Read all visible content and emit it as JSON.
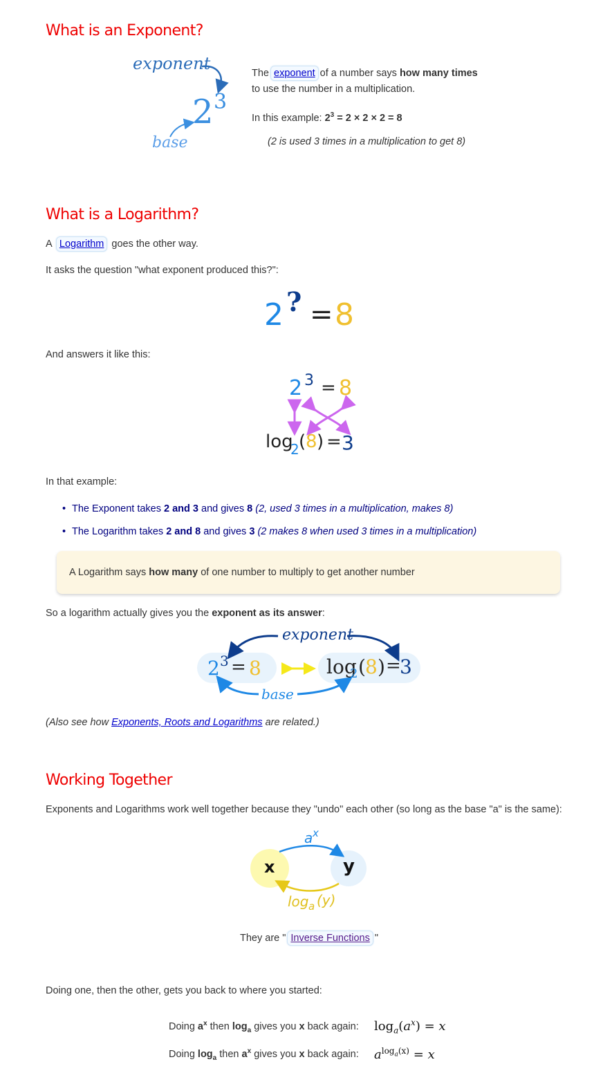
{
  "section1": {
    "heading": "What is an Exponent?",
    "figure": {
      "exponent_label": "exponent",
      "base_label": "base",
      "base": "2",
      "power": "3"
    },
    "p1_pre": "The",
    "p1_link": "exponent",
    "p1_mid": "of a number says",
    "p1_bold": "how many times",
    "p1_line2": "to use the number in a multiplication.",
    "p2_pre": "In this example:",
    "p2_base": "2",
    "p2_sup": "3",
    "p2_rest": "= 2 × 2 × 2 = 8",
    "p3": "(2 is used 3 times in a multiplication to get 8)"
  },
  "section2": {
    "heading": "What is a Logarithm?",
    "p1_pre": "A",
    "p1_link": "Logarithm",
    "p1_post": "goes the other way.",
    "p2": "It asks the question \"what exponent produced this?\":",
    "question": {
      "base": "2",
      "sup": "?",
      "eq": "=",
      "result": "8"
    },
    "p3": "And answers it like this:",
    "answer_fig": {
      "base": "2",
      "sup": "3",
      "eq": "=",
      "result": "8",
      "log": "log",
      "log_base": "2",
      "open": "(",
      "arg": "8",
      "close": ")",
      "eq2": "=",
      "answer": "3"
    },
    "p4": "In that example:",
    "bullets": [
      {
        "a": "The Exponent takes",
        "b": "2 and 3",
        "c": "and gives",
        "d": "8",
        "e": "(2, used 3 times in a multiplication, makes 8)"
      },
      {
        "a": "The Logarithm takes",
        "b": "2 and 8",
        "c": "and gives",
        "d": "3",
        "e": "(2 makes 8 when used 3 times in a multiplication)"
      }
    ],
    "note": {
      "pre": "A Logarithm says",
      "bold": "how many",
      "post": "of one number to multiply to get another number"
    },
    "p5_pre": "So a logarithm actually gives you the",
    "p5_bold": "exponent as its answer",
    "p5_post": ":",
    "diagram": {
      "exponent_label": "exponent",
      "base_label": "base",
      "left_base": "2",
      "left_sup": "3",
      "left_eq": "=",
      "left_result": "8",
      "log": "log",
      "log_base": "2",
      "open": "(",
      "arg": "8",
      "close": ")",
      "eq": "=",
      "answer": "3"
    },
    "p6_pre": "(Also see how",
    "p6_link": "Exponents, Roots and Logarithms",
    "p6_post": "are related.)"
  },
  "section3": {
    "heading": "Working Together",
    "p1": "Exponents and Logarithms work well together because they \"undo\" each other (so long as the base \"a\" is the same):",
    "fig": {
      "x": "x",
      "y": "y",
      "top_base": "a",
      "top_sup": "x",
      "bottom_log": "log",
      "bottom_sub": "a",
      "bottom_arg": "(y)"
    },
    "p2_pre": "They are \"",
    "p2_link": "Inverse Functions",
    "p2_post": "\"",
    "p3": "Doing one, then the other, gets you back to where you started:",
    "row1": {
      "a": "Doing",
      "b": "a",
      "b_sup": "x",
      "c": "then",
      "d": "log",
      "d_sub": "a",
      "e": "gives you",
      "f": "x",
      "g": "back again:",
      "m_log": "log",
      "m_sub": "a",
      "m_open": "(",
      "m_a": "a",
      "m_sup": "x",
      "m_close": ")",
      "m_eq": "=",
      "m_x": "x"
    },
    "row2": {
      "a": "Doing",
      "b": "log",
      "b_sub": "a",
      "c": "then",
      "d": "a",
      "d_sup": "x",
      "e": "gives you",
      "f": "x",
      "g": "back again:",
      "m_a": "a",
      "m_sup_log": "log",
      "m_sup_sub": "a",
      "m_sup_arg": "(x)",
      "m_eq": "=",
      "m_x": "x"
    }
  },
  "colors": {
    "heading": "#ee0000",
    "light_blue": "#1e88e5",
    "navy": "#0d3c8c",
    "gold": "#f0c030",
    "magenta": "#cc66ee",
    "note_bg": "#fdf6e2",
    "list_text": "#000080"
  }
}
